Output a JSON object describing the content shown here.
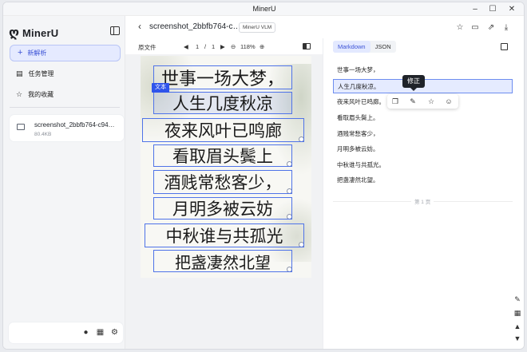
{
  "app": {
    "title": "MinerU"
  },
  "sidebar": {
    "logo_mark": "ღ",
    "logo_text": "MinerU",
    "new_parse": "新解析",
    "items": [
      {
        "label": "任务管理",
        "icon": "document-icon"
      },
      {
        "label": "我的收藏",
        "icon": "star-icon"
      }
    ],
    "file": {
      "name": "screenshot_2bbfb764-c94…",
      "size": "80.4KB"
    }
  },
  "header": {
    "doc_title": "screenshot_2bbfb764-c…",
    "model_tag": "MinerU VLM"
  },
  "viewer": {
    "label": "原文件",
    "page_current": "1",
    "page_sep": "/",
    "page_total": "1",
    "zoom": "118%",
    "tag_label": "文本",
    "lines": [
      "世事一场大梦，",
      "人生几度秋凉",
      "夜来风叶已鸣廊",
      "看取眉头鬓上",
      "酒贱常愁客少，",
      "月明多被云妨",
      "中秋谁与共孤光",
      "把盏凄然北望"
    ]
  },
  "result": {
    "tabs": [
      "Markdown",
      "JSON"
    ],
    "lines": [
      "世事一场大梦，",
      "人生几度秋凉。",
      "夜来风叶已鸣廊。",
      "看取眉头鬓上。",
      "酒贱常愁客少，",
      "月明多被云妨。",
      "中秋谁与共孤光。",
      "把盏凄然北望。"
    ],
    "tooltip": "修正",
    "page_label": "第 1 页"
  }
}
